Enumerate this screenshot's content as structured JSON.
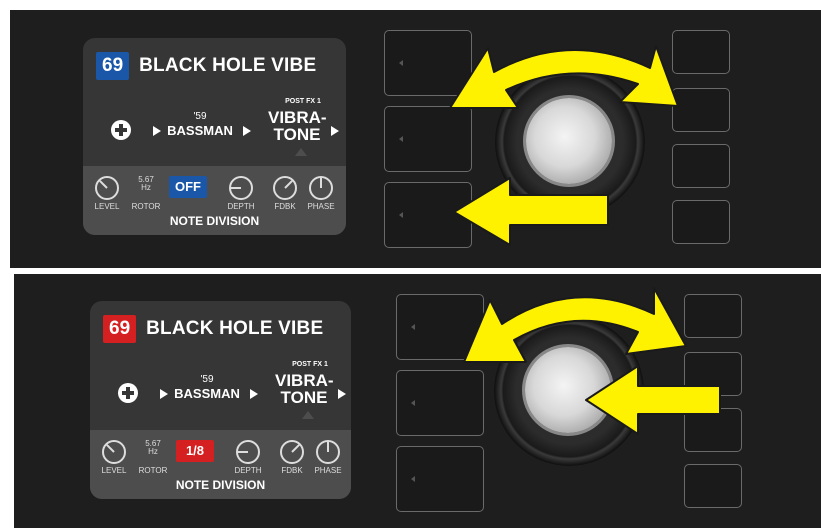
{
  "panels": [
    {
      "preset": {
        "number": "69",
        "number_color": "#1a57a8",
        "name": "BLACK HOLE VIBE"
      },
      "signal_chain": {
        "amp_year": "'59",
        "amp": "BASSMAN",
        "fx_slot": "POST FX 1",
        "fx_line1": "VIBRA-",
        "fx_line2": "TONE"
      },
      "controls": {
        "level": "LEVEL",
        "rotor": "ROTOR",
        "rotor_value": "5.67",
        "rotor_unit": "Hz",
        "selector_value": "OFF",
        "selector_color": "#1a57a8",
        "depth": "DEPTH",
        "fdbk": "FDBK",
        "phase": "PHASE",
        "section_label": "NOTE DIVISION"
      },
      "gesture": "rotate-and-press-left"
    },
    {
      "preset": {
        "number": "69",
        "number_color": "#d42020",
        "name": "BLACK HOLE VIBE"
      },
      "signal_chain": {
        "amp_year": "'59",
        "amp": "BASSMAN",
        "fx_slot": "POST FX 1",
        "fx_line1": "VIBRA-",
        "fx_line2": "TONE"
      },
      "controls": {
        "level": "LEVEL",
        "rotor": "ROTOR",
        "rotor_value": "5.67",
        "rotor_unit": "Hz",
        "selector_value": "1/8",
        "selector_color": "#d42020",
        "depth": "DEPTH",
        "fdbk": "FDBK",
        "phase": "PHASE",
        "section_label": "NOTE DIVISION"
      },
      "gesture": "rotate-and-press-dial"
    }
  ],
  "colors": {
    "arrow": "#fff200",
    "arrow_outline": "#1a1a1a"
  }
}
